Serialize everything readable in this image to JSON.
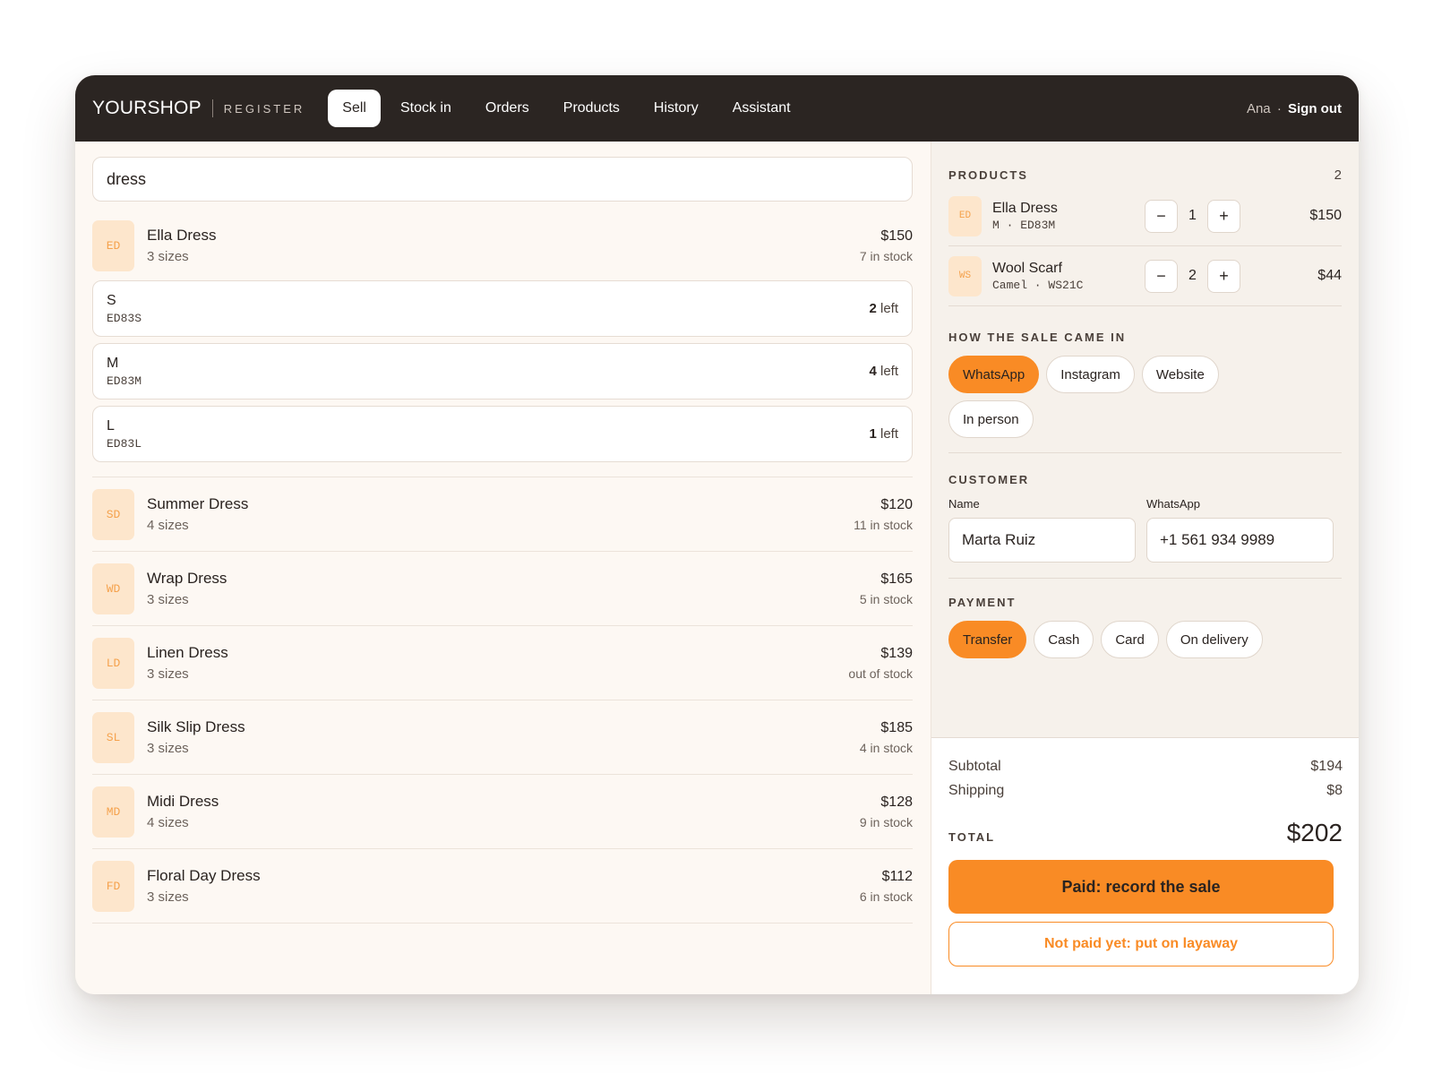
{
  "header": {
    "brand": "YOURSHOP",
    "brand_sub": "REGISTER",
    "tabs": [
      {
        "label": "Sell",
        "active": true
      },
      {
        "label": "Stock in",
        "active": false
      },
      {
        "label": "Orders",
        "active": false
      },
      {
        "label": "Products",
        "active": false
      },
      {
        "label": "History",
        "active": false
      },
      {
        "label": "Assistant",
        "active": false
      }
    ],
    "user_name": "Ana",
    "user_sep": "·",
    "sign_out": "Sign out"
  },
  "search": {
    "value": "dress"
  },
  "expanded_product": {
    "initials": "ED",
    "name": "Ella Dress",
    "sub": "3 sizes",
    "price": "$150",
    "stock": "7 in stock",
    "sizes": [
      {
        "label": "S",
        "sku": "ED83S",
        "count": "2",
        "suffix": " left"
      },
      {
        "label": "M",
        "sku": "ED83M",
        "count": "4",
        "suffix": " left"
      },
      {
        "label": "L",
        "sku": "ED83L",
        "count": "1",
        "suffix": " left"
      }
    ]
  },
  "products": [
    {
      "initials": "SD",
      "name": "Summer Dress",
      "sub": "4 sizes",
      "price": "$120",
      "stock": "11 in stock"
    },
    {
      "initials": "WD",
      "name": "Wrap Dress",
      "sub": "3 sizes",
      "price": "$165",
      "stock": "5 in stock"
    },
    {
      "initials": "LD",
      "name": "Linen Dress",
      "sub": "3 sizes",
      "price": "$139",
      "stock": "out of stock"
    },
    {
      "initials": "SL",
      "name": "Silk Slip Dress",
      "sub": "3 sizes",
      "price": "$185",
      "stock": "4 in stock"
    },
    {
      "initials": "MD",
      "name": "Midi Dress",
      "sub": "4 sizes",
      "price": "$128",
      "stock": "9 in stock"
    },
    {
      "initials": "FD",
      "name": "Floral Day Dress",
      "sub": "3 sizes",
      "price": "$112",
      "stock": "6 in stock"
    }
  ],
  "cart": {
    "title": "PRODUCTS",
    "count": "2",
    "items": [
      {
        "initials": "ED",
        "name": "Ella Dress",
        "sku": "M · ED83M",
        "qty": "1",
        "price": "$150"
      },
      {
        "initials": "WS",
        "name": "Wool Scarf",
        "sku": "Camel · WS21C",
        "qty": "2",
        "price": "$44"
      }
    ],
    "minus": "−",
    "plus": "+"
  },
  "channel": {
    "title": "HOW THE SALE CAME IN",
    "options": [
      {
        "label": "WhatsApp",
        "active": true
      },
      {
        "label": "Instagram",
        "active": false
      },
      {
        "label": "Website",
        "active": false
      },
      {
        "label": "In person",
        "active": false
      }
    ]
  },
  "customer": {
    "title": "CUSTOMER",
    "name_label": "Name",
    "name_value": "Marta Ruiz",
    "phone_label": "WhatsApp",
    "phone_value": "+1 561 934 9989"
  },
  "payment": {
    "title": "PAYMENT",
    "options": [
      {
        "label": "Transfer",
        "active": true
      },
      {
        "label": "Cash",
        "active": false
      },
      {
        "label": "Card",
        "active": false
      },
      {
        "label": "On delivery",
        "active": false
      }
    ]
  },
  "summary": {
    "subtotal_label": "Subtotal",
    "subtotal": "$194",
    "shipping_label": "Shipping",
    "shipping": "$8",
    "total_label": "TOTAL",
    "total": "$202",
    "primary_button": "Paid: record the sale",
    "secondary_button": "Not paid yet: put on layaway"
  },
  "colors": {
    "accent": "#f98b25",
    "topbar": "#2b2522",
    "avatar_bg": "#fde6cc"
  }
}
